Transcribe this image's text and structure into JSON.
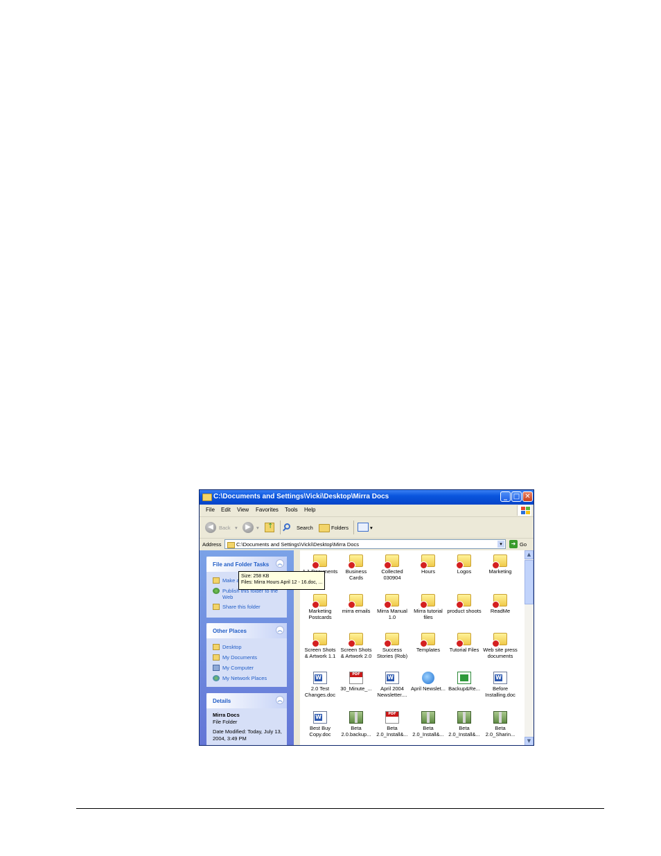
{
  "window": {
    "title": "C:\\Documents and Settings\\Vicki\\Desktop\\Mirra Docs"
  },
  "menu": [
    "File",
    "Edit",
    "View",
    "Favorites",
    "Tools",
    "Help"
  ],
  "toolbar": {
    "back": "Back",
    "search": "Search",
    "folders": "Folders"
  },
  "address": {
    "label": "Address",
    "value": "C:\\Documents and Settings\\Vicki\\Desktop\\Mirra Docs",
    "go": "Go"
  },
  "file_folder_tasks": {
    "title": "File and Folder Tasks",
    "items": [
      "Make a new folder",
      "Publish this folder to the Web",
      "Share this folder"
    ]
  },
  "other_places": {
    "title": "Other Places",
    "items": [
      "Desktop",
      "My Documents",
      "My Computer",
      "My Network Places"
    ]
  },
  "details": {
    "title": "Details",
    "name": "Mirra Docs",
    "type": "File Folder",
    "modified": "Date Modified: Today, July 13, 2004, 3:49 PM"
  },
  "files": [
    {
      "label": "1.1 Documents",
      "icon": "shared-folder-icon"
    },
    {
      "label": "Business Cards",
      "icon": "shared-folder-icon"
    },
    {
      "label": "Collected 030904",
      "icon": "shared-folder-icon"
    },
    {
      "label": "Hours",
      "icon": "shared-folder-icon"
    },
    {
      "label": "Logos",
      "icon": "shared-folder-icon"
    },
    {
      "label": "Marketing",
      "icon": "shared-folder-icon"
    },
    {
      "label": "Marketing Postcards",
      "icon": "shared-folder-icon"
    },
    {
      "label": "mirra emails",
      "icon": "shared-folder-icon"
    },
    {
      "label": "Mirra Manual 1.0",
      "icon": "shared-folder-icon"
    },
    {
      "label": "Mirra tutorial files",
      "icon": "shared-folder-icon"
    },
    {
      "label": "product shoots",
      "icon": "shared-folder-icon"
    },
    {
      "label": "ReadMe",
      "icon": "shared-folder-icon"
    },
    {
      "label": "Screen Shots & Artwork 1.1",
      "icon": "shared-folder-icon"
    },
    {
      "label": "Screen Shots & Artwork 2.0",
      "icon": "shared-folder-icon"
    },
    {
      "label": "Success Stories (Rob)",
      "icon": "shared-folder-icon"
    },
    {
      "label": "Templates",
      "icon": "shared-folder-icon"
    },
    {
      "label": "Tutorial Files",
      "icon": "shared-folder-icon"
    },
    {
      "label": "Web site press documents",
      "icon": "shared-folder-icon"
    },
    {
      "label": "2.0 Test Changes.doc",
      "icon": "word-doc-icon"
    },
    {
      "label": "30_Minute_...",
      "icon": "pdf-icon"
    },
    {
      "label": "April 2004 Newsletter....",
      "icon": "word-doc-icon"
    },
    {
      "label": "April Newslet...",
      "icon": "ie-html-icon"
    },
    {
      "label": "Backup&Re...",
      "icon": "spreadsheet-icon"
    },
    {
      "label": "Before Installing.doc",
      "icon": "word-doc-icon"
    },
    {
      "label": "Best Buy Copy.doc",
      "icon": "word-doc-icon"
    },
    {
      "label": "Beta 2.0.backup...",
      "icon": "zip-icon"
    },
    {
      "label": "Beta 2.0_Install&...",
      "icon": "pdf-icon"
    },
    {
      "label": "Beta 2.0_Install&...",
      "icon": "zip-icon"
    },
    {
      "label": "Beta 2.0_Install&...",
      "icon": "zip-icon"
    },
    {
      "label": "Beta 2.0_Sharin...",
      "icon": "zip-icon"
    }
  ],
  "tooltip": {
    "size": "Size: 258 KB",
    "files": "Files: Mirra Hours  April 12 - 16.doc, ..."
  }
}
